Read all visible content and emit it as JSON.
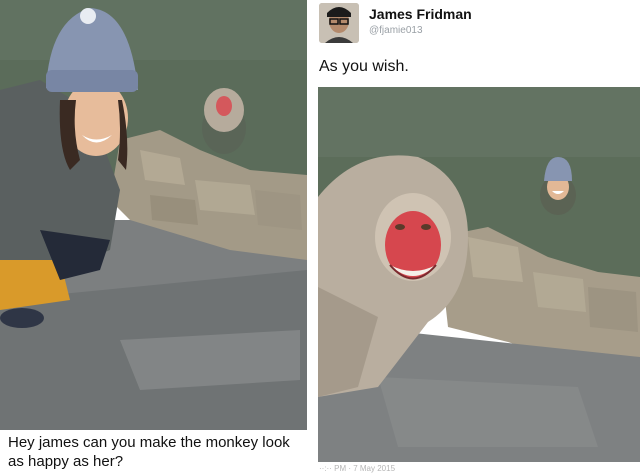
{
  "left": {
    "caption": "Hey james can you make the monkey look as happy as her?"
  },
  "right": {
    "user": {
      "name": "James Fridman",
      "handle": "@fjamie013",
      "avatar": "avatar-icon"
    },
    "tweet_text": "As you wish.",
    "meta": "··:·· PM · 7 May 2015"
  },
  "colors": {
    "water": "#5c6d5a",
    "stone": "#a59b88",
    "ground": "#7f8282",
    "hat": "#8e9bb5",
    "monkey_face": "#d7474e",
    "monkey_fur": "#b9aea0"
  }
}
